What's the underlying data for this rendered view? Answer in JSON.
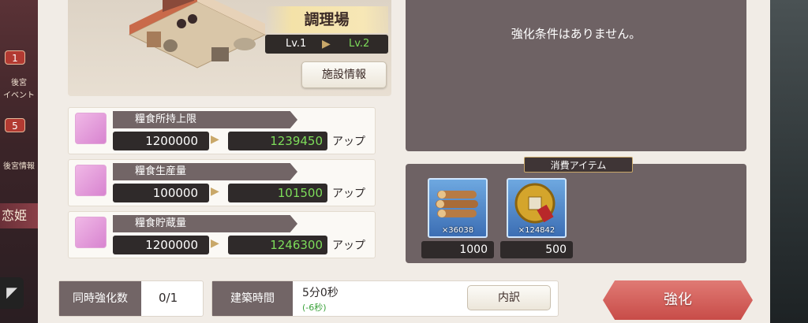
{
  "facility": {
    "name": "調理場",
    "level_current": "Lv.1",
    "level_next": "Lv.2",
    "info_button": "施設情報"
  },
  "stats": [
    {
      "label": "糧食所持上限",
      "current": "1200000",
      "next": "1239450",
      "up": "アップ"
    },
    {
      "label": "糧食生産量",
      "current": "100000",
      "next": "101500",
      "up": "アップ"
    },
    {
      "label": "糧食貯蔵量",
      "current": "1200000",
      "next": "1246300",
      "up": "アップ"
    }
  ],
  "conditions": {
    "text": "強化条件はありません。"
  },
  "consume": {
    "title": "消費アイテム",
    "items": [
      {
        "icon": "wood-logs-icon",
        "owned": "×36038",
        "required": "1000"
      },
      {
        "icon": "coin-icon",
        "owned": "×124842",
        "required": "500"
      }
    ]
  },
  "footer": {
    "concurrent_label": "同時強化数",
    "concurrent_value": "0/1",
    "build_time_label": "建築時間",
    "build_time_value": "5分0秒",
    "build_time_reduction": "(-6秒)",
    "detail_button": "内訳",
    "enhance_button": "強化"
  },
  "side": {
    "badge_top": "1",
    "badge_top_text_1": "後宮",
    "badge_top_text_2": "イベント",
    "badge_bottom": "5",
    "badge_bottom_text": "後宮情報",
    "banner": "恋姫"
  },
  "colors": {
    "accent_green": "#7ddc5a",
    "label_bg": "#726566",
    "enhance_red": "#d05a56"
  }
}
